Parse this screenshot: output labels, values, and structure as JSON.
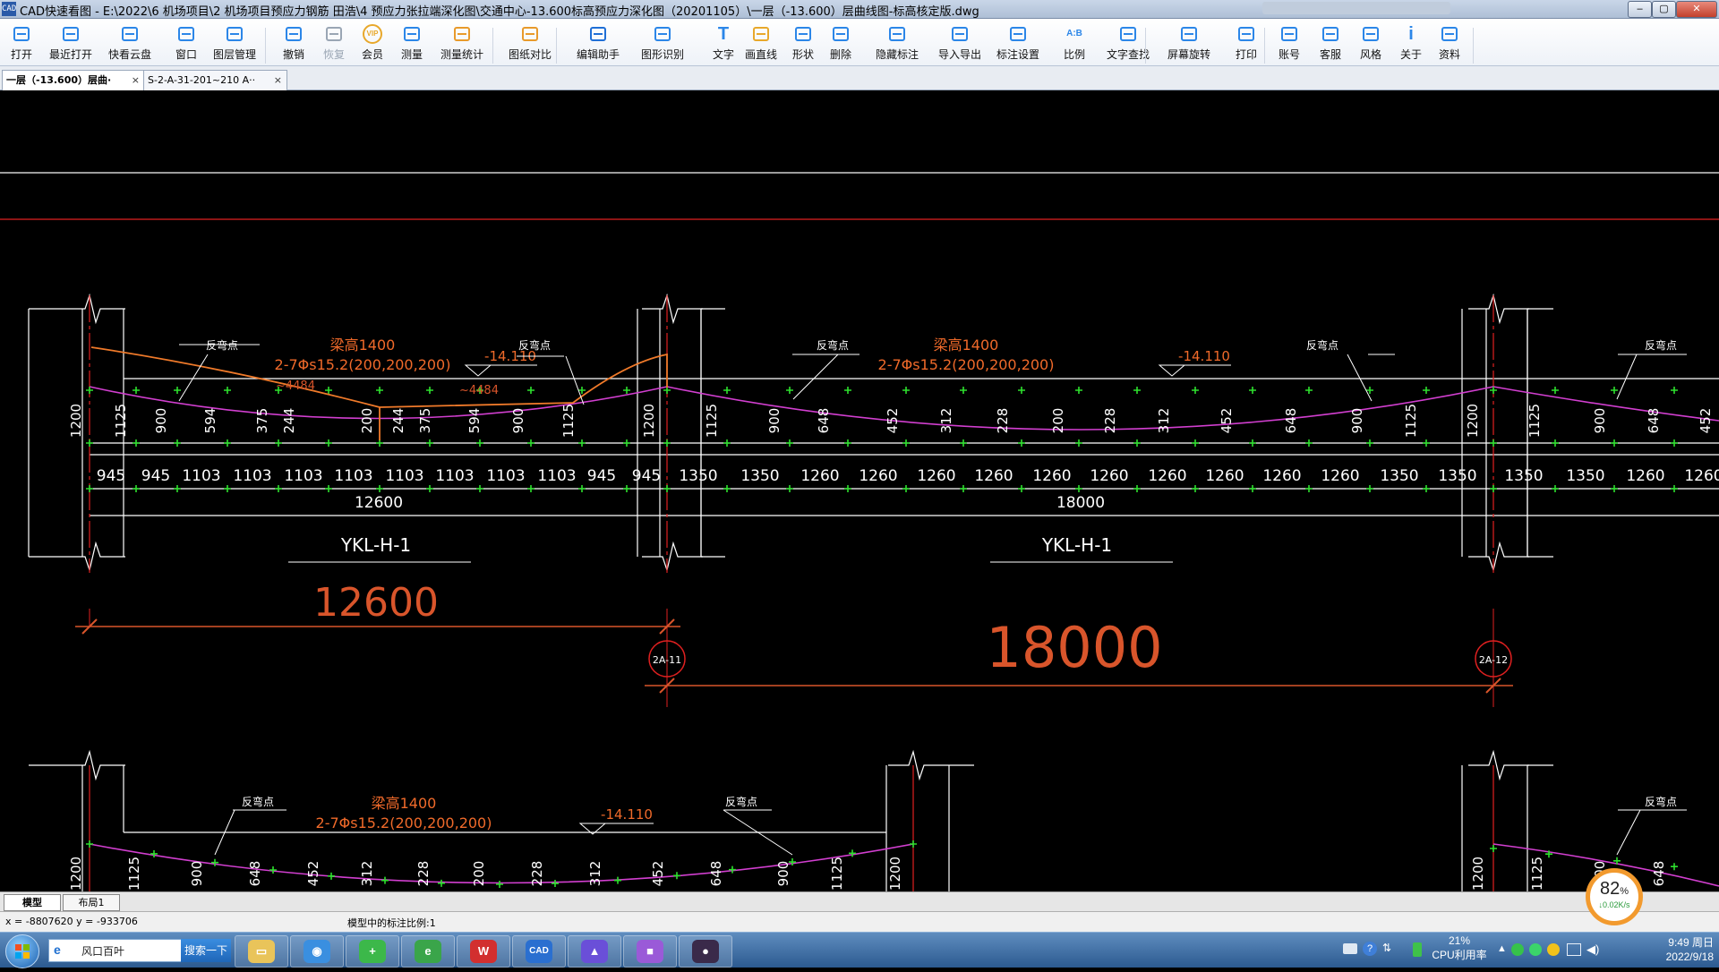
{
  "window": {
    "app_icon_text": "CAD",
    "title": "CAD快速看图 - E:\\2022\\6 机场项目\\2 机场项目预应力钢筋 田浩\\4 预应力张拉端深化图\\交通中心-13.600标高预应力深化图（20201105）\\一层（-13.600）层曲线图-标高核定版.dwg",
    "controls": [
      "–",
      "▢",
      "✕"
    ]
  },
  "toolbar": {
    "buttons": [
      {
        "label": "打开",
        "icon": "folder-open-icon"
      },
      {
        "label": "最近打开",
        "icon": "recent-icon"
      },
      {
        "label": "快看云盘",
        "icon": "cloud-icon"
      },
      {
        "label": "窗口",
        "icon": "window-icon"
      },
      {
        "label": "图层管理",
        "icon": "layers-icon"
      },
      {
        "label": "撤销",
        "icon": "undo-icon"
      },
      {
        "label": "恢复",
        "icon": "redo-icon"
      },
      {
        "label": "会员",
        "icon": "vip-icon",
        "badge": "VIP"
      },
      {
        "label": "测量",
        "icon": "measure-icon"
      },
      {
        "label": "测量统计",
        "icon": "measure-stats-icon"
      },
      {
        "label": "图纸对比",
        "icon": "compare-icon"
      },
      {
        "label": "编辑助手",
        "icon": "edit-assistant-icon"
      },
      {
        "label": "图形识别",
        "icon": "shape-recognize-icon"
      },
      {
        "label": "文字",
        "icon": "text-icon",
        "glyph": "T"
      },
      {
        "label": "画直线",
        "icon": "line-icon"
      },
      {
        "label": "形状",
        "icon": "shape-icon"
      },
      {
        "label": "删除",
        "icon": "eraser-icon"
      },
      {
        "label": "隐藏标注",
        "icon": "hide-annotation-icon"
      },
      {
        "label": "导入导出",
        "icon": "import-export-icon"
      },
      {
        "label": "标注设置",
        "icon": "annotation-settings-icon"
      },
      {
        "label": "比例",
        "icon": "scale-icon",
        "glyph": "A:B"
      },
      {
        "label": "文字查找",
        "icon": "text-search-icon"
      },
      {
        "label": "屏幕旋转",
        "icon": "rotate-screen-icon"
      },
      {
        "label": "打印",
        "icon": "print-icon"
      },
      {
        "label": "账号",
        "icon": "account-icon"
      },
      {
        "label": "客服",
        "icon": "headset-icon"
      },
      {
        "label": "风格",
        "icon": "style-icon"
      },
      {
        "label": "关于",
        "icon": "info-icon",
        "glyph": "i"
      },
      {
        "label": "资料",
        "icon": "documents-icon"
      }
    ]
  },
  "tabs": [
    {
      "label": "一层（-13.600）层曲·",
      "close": "×"
    },
    {
      "label": "S-2-A-31-201~210 A··",
      "close": "×"
    }
  ],
  "drawing": {
    "dims_row1_left": [
      "1200",
      "1125",
      "900",
      "594",
      "375",
      "244",
      "200",
      "244",
      "375",
      "594",
      "900",
      "1125",
      "1200"
    ],
    "dims_row1_right": [
      "1125",
      "900",
      "648",
      "452",
      "312",
      "228",
      "200",
      "228",
      "312",
      "452",
      "648",
      "900",
      "1125",
      "1200",
      "1125",
      "900",
      "648",
      "452"
    ],
    "dims_row2_left": [
      "945",
      "945",
      "1103",
      "1103",
      "1103",
      "1103",
      "1103",
      "1103",
      "1103",
      "1103",
      "945",
      "945"
    ],
    "dims_row2_right": [
      "1350",
      "1350",
      "1260",
      "1260",
      "1260",
      "1260",
      "1260",
      "1260",
      "1260",
      "1260",
      "1260",
      "1260",
      "1350",
      "1350",
      "1350",
      "1350",
      "1260",
      "1260"
    ],
    "span_left": "12600",
    "span_right": "18000",
    "beam_label": "YKL-H-1",
    "big_dim_left": "12600",
    "big_dim_right": "18000",
    "axis_left": "2A-11",
    "axis_right": "2A-12",
    "beam_height_note": "梁高1400",
    "tendon_spec": "2-7Φs15.2(200,200,200)",
    "inflection_label": "反弯点",
    "elevation": "-14.110",
    "orange_note_1": "~4484",
    "orange_note_2": "~4484",
    "lower_dims_left": [
      "1200",
      "1125",
      "900",
      "648",
      "452",
      "312",
      "228",
      "200",
      "228",
      "312",
      "452",
      "648",
      "900",
      "1125",
      "1200"
    ],
    "lower_dims_right": [
      "1200",
      "1125",
      "900",
      "648"
    ]
  },
  "layout_tabs": [
    "模型",
    "布局1"
  ],
  "status": {
    "coords": "x = -8807620  y = -933706",
    "scale_note": "模型中的标注比例:1"
  },
  "taskbar": {
    "search_text": "风口百叶",
    "search_button": "搜索一下",
    "apps": [
      "explorer",
      "browser-360",
      "green-app",
      "ie-green",
      "wps-office",
      "cad-viewer",
      "picture-app",
      "purple-app",
      "avatar-app"
    ],
    "cpu_percent": "21%",
    "cpu_label": "CPU利用率",
    "time": "9:49 周日",
    "date": "2022/9/18"
  },
  "cpu_widget": {
    "value": "82",
    "unit": "%",
    "rate": "↓0.02K/s"
  },
  "colors": {
    "wall": "#ffffff",
    "tendon": "#d23fd0",
    "node": "#2ee02e",
    "axis": "#e02020",
    "dim_orange": "#d9552b",
    "note_orange": "#f06a2a"
  }
}
